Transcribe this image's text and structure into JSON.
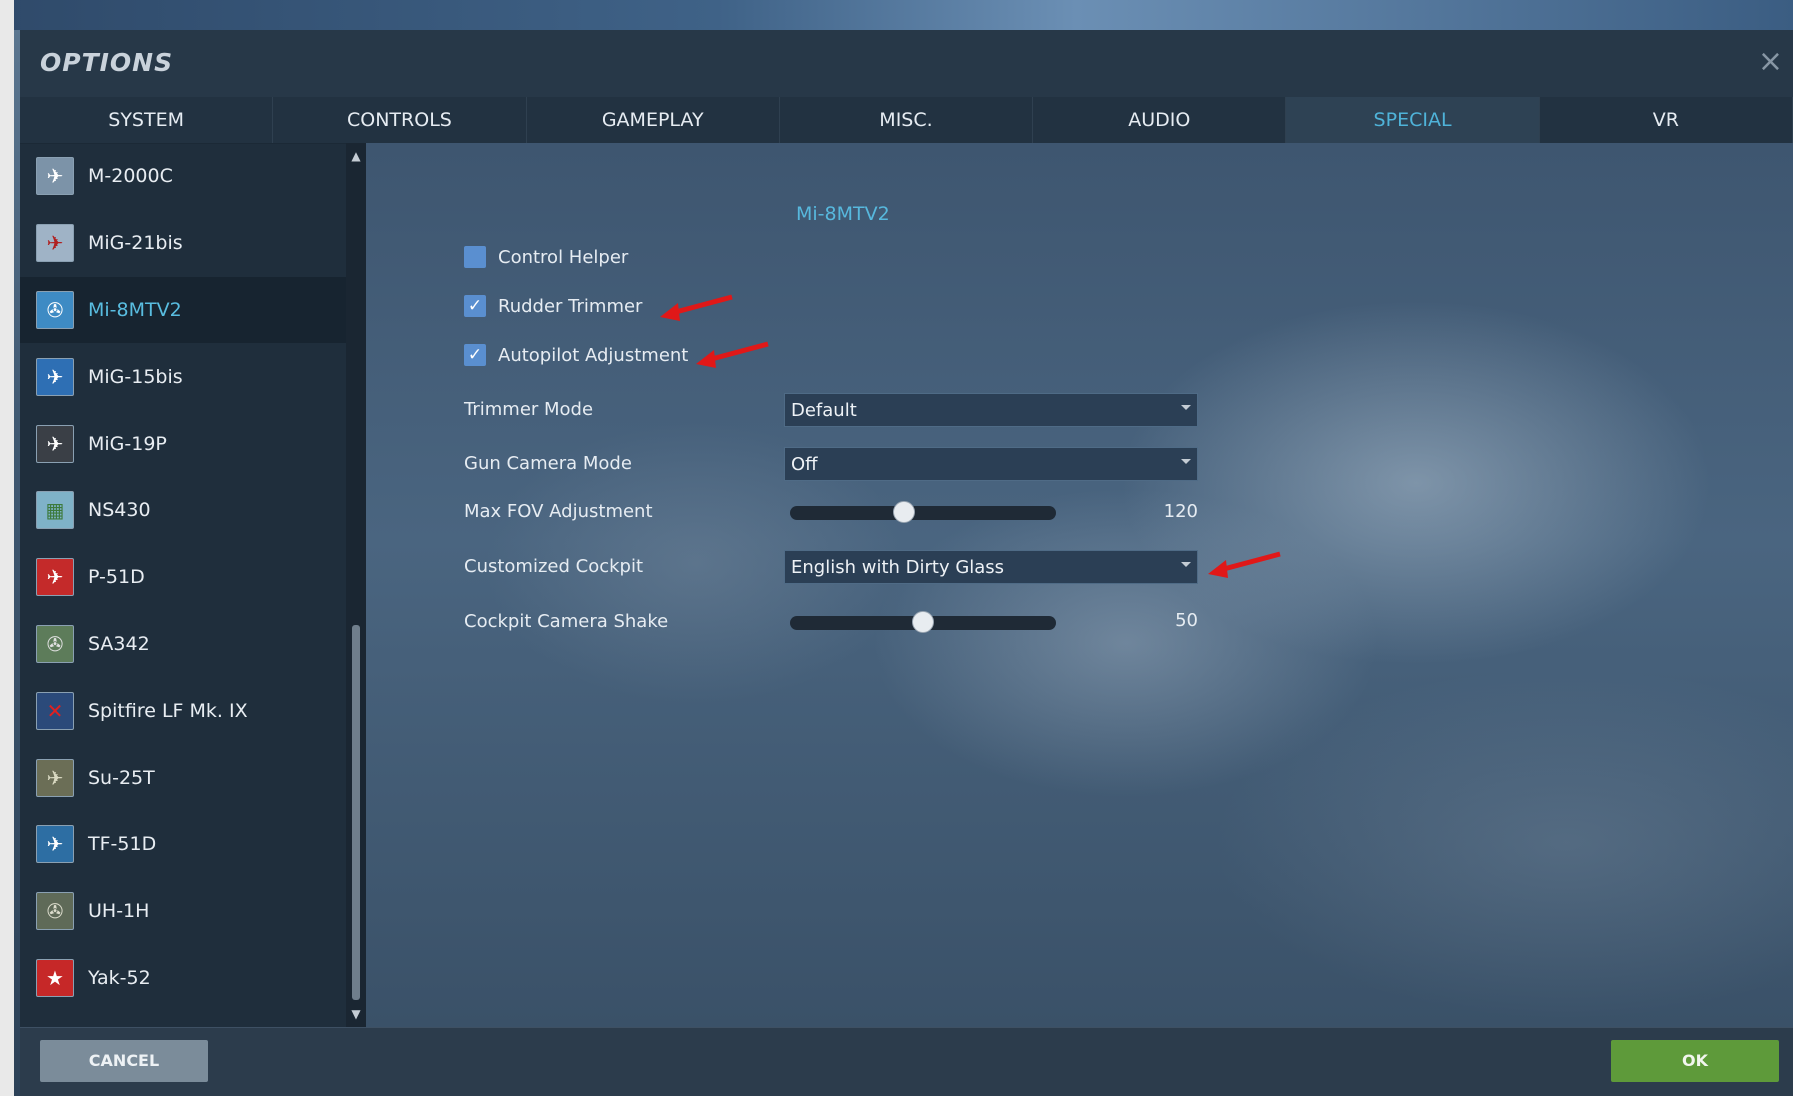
{
  "window": {
    "title": "OPTIONS",
    "close_glyph": "×"
  },
  "tabs": [
    {
      "label": "SYSTEM"
    },
    {
      "label": "CONTROLS"
    },
    {
      "label": "GAMEPLAY"
    },
    {
      "label": "MISC."
    },
    {
      "label": "AUDIO"
    },
    {
      "label": "SPECIAL",
      "active": true
    },
    {
      "label": "VR"
    }
  ],
  "sidebar": {
    "selected": "Mi-8MTV2",
    "items": [
      {
        "label": "M-2000C",
        "icon": "m2000c-aircraft-icon"
      },
      {
        "label": "MiG-21bis",
        "icon": "mig21-aircraft-icon"
      },
      {
        "label": "Mi-8MTV2",
        "icon": "mi8-helicopter-icon"
      },
      {
        "label": "MiG-15bis",
        "icon": "mig15-aircraft-icon"
      },
      {
        "label": "MiG-19P",
        "icon": "mig19-aircraft-icon"
      },
      {
        "label": "NS430",
        "icon": "ns430-map-icon"
      },
      {
        "label": "P-51D",
        "icon": "p51d-aircraft-icon"
      },
      {
        "label": "SA342",
        "icon": "sa342-helicopter-icon"
      },
      {
        "label": "Spitfire LF Mk. IX",
        "icon": "spitfire-aircraft-icon"
      },
      {
        "label": "Su-25T",
        "icon": "su25t-aircraft-icon"
      },
      {
        "label": "TF-51D",
        "icon": "tf51d-aircraft-icon"
      },
      {
        "label": "UH-1H",
        "icon": "uh1h-helicopter-icon"
      },
      {
        "label": "Yak-52",
        "icon": "yak52-aircraft-icon"
      }
    ]
  },
  "special": {
    "section_title": "Mi-8MTV2",
    "control_helper": {
      "label": "Control Helper",
      "checked": false
    },
    "rudder_trimmer": {
      "label": "Rudder Trimmer",
      "checked": true
    },
    "autopilot_adjustment": {
      "label": "Autopilot Adjustment",
      "checked": true
    },
    "trimmer_mode": {
      "label": "Trimmer Mode",
      "value": "Default"
    },
    "gun_camera_mode": {
      "label": "Gun Camera Mode",
      "value": "Off"
    },
    "max_fov": {
      "label": "Max FOV Adjustment",
      "value": "120",
      "fill": 0.43
    },
    "customized_cockpit": {
      "label": "Customized Cockpit",
      "value": "English with Dirty Glass"
    },
    "cockpit_camera_shake": {
      "label": "Cockpit Camera Shake",
      "value": "50",
      "fill": 0.5
    }
  },
  "footer": {
    "cancel_label": "CANCEL",
    "ok_label": "OK"
  },
  "colors": {
    "accent": "#57b8dd",
    "ok_green": "#5e9a3a",
    "arrow_red": "#e01818"
  }
}
